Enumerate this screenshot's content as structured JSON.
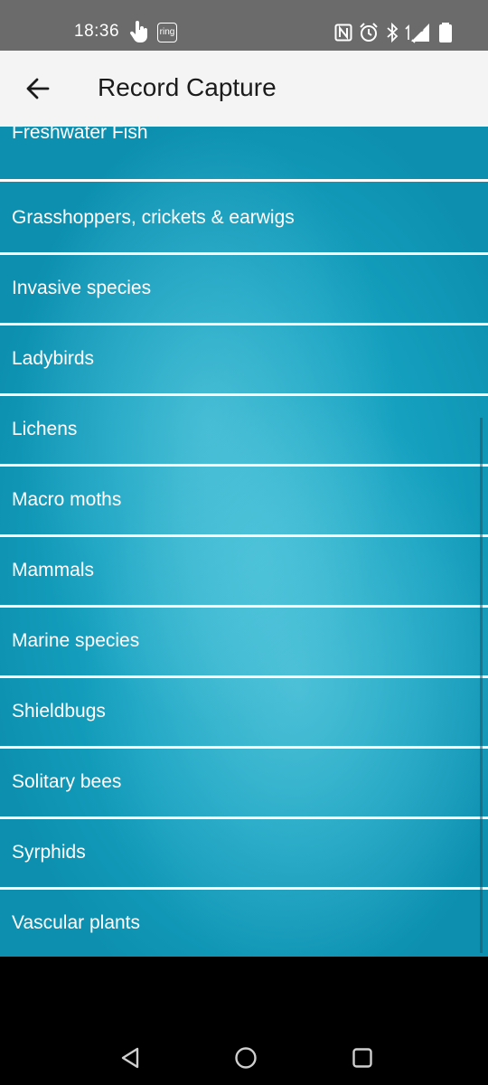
{
  "status_bar": {
    "time": "18:36",
    "ring_badge": "ring",
    "icons": [
      "touch-hand-icon",
      "ring-app-icon",
      "nfc-icon",
      "alarm-icon",
      "bluetooth-icon",
      "signal-4g-icon",
      "battery-icon"
    ],
    "network_label": "4G"
  },
  "app_bar": {
    "title": "Record Capture",
    "back_icon": "arrow-left-icon"
  },
  "colors": {
    "list_background": "#16a1c0",
    "list_highlight": "#78d7e8",
    "app_bar_bg": "#f4f4f4",
    "status_bar_bg": "#6b6b6b",
    "divider": "#ffffff"
  },
  "list": {
    "items": [
      {
        "label": "Freshwater Fish"
      },
      {
        "label": "Grasshoppers, crickets & earwigs"
      },
      {
        "label": "Invasive species"
      },
      {
        "label": "Ladybirds"
      },
      {
        "label": "Lichens"
      },
      {
        "label": "Macro moths"
      },
      {
        "label": "Mammals"
      },
      {
        "label": "Marine species"
      },
      {
        "label": "Shieldbugs"
      },
      {
        "label": "Solitary bees"
      },
      {
        "label": "Syrphids"
      },
      {
        "label": "Vascular plants"
      }
    ]
  },
  "nav_bar": {
    "icons": [
      "back-triangle-icon",
      "home-circle-icon",
      "recents-square-icon"
    ]
  }
}
